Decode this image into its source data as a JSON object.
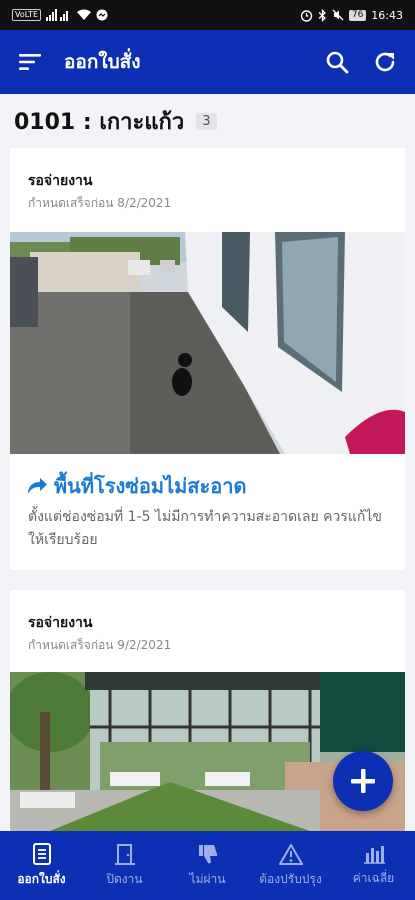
{
  "status_bar": {
    "left_badge": "VoLTE",
    "battery": "76",
    "time": "16:43"
  },
  "app_bar": {
    "title": "ออกใบสั่ง"
  },
  "section": {
    "title": "0101 : เกาะแก้ว",
    "count": "3"
  },
  "cards": [
    {
      "status": "รอจ่ายงาน",
      "due": "กำหนดเสร็จก่อน 8/2/2021",
      "headline": "พื้นที่โรงซ่อมไม่สะอาด",
      "description": "ตั้งแต่ช่องซ่อมที่ 1-5 ไม่มีการทำความสะอาดเลย ควรแก้ไขให้เรียบร้อย"
    },
    {
      "status": "รอจ่ายงาน",
      "due": "กำหนดเสร็จก่อน 9/2/2021"
    }
  ],
  "bottom_nav": [
    {
      "label": "ออกใบสั่ง",
      "icon": "document-list-icon",
      "active": true
    },
    {
      "label": "ปิดงาน",
      "icon": "door-icon",
      "active": false
    },
    {
      "label": "ไม่ผ่าน",
      "icon": "thumbs-down-icon",
      "active": false
    },
    {
      "label": "ต้องปรับปรุง",
      "icon": "warning-icon",
      "active": false
    },
    {
      "label": "ค่าเฉลี่ย",
      "icon": "bar-chart-icon",
      "active": false
    }
  ],
  "colors": {
    "primary": "#0d2fb4",
    "link": "#1b7ad6"
  }
}
